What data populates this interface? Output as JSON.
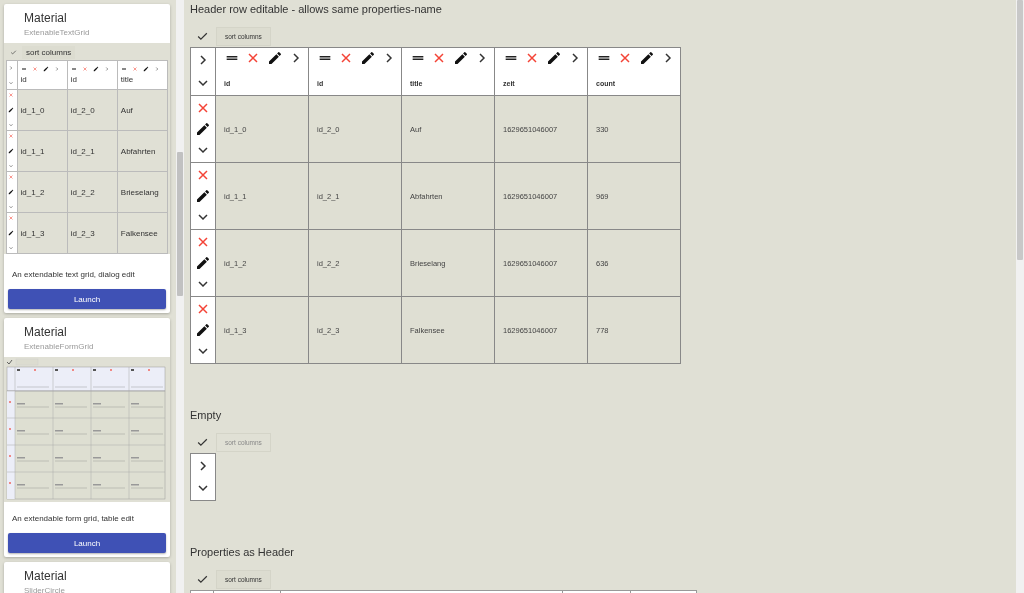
{
  "sidebar": {
    "cards": [
      {
        "title": "Material",
        "subtitle": "ExtenableTextGrid",
        "preview": {
          "kind": "text_grid",
          "sort_label": "sort columns",
          "columns": [
            "id",
            "id",
            "title"
          ],
          "rows": [
            [
              "id_1_0",
              "id_2_0",
              "Auf"
            ],
            [
              "id_1_1",
              "id_2_1",
              "Abfahrten"
            ],
            [
              "id_1_2",
              "id_2_2",
              "Brieselang"
            ],
            [
              "id_1_3",
              "id_2_3",
              "Falkensee"
            ]
          ]
        },
        "description": "An extendable text grid, dialog edit",
        "button": "Launch"
      },
      {
        "title": "Material",
        "subtitle": "ExtenableFormGrid",
        "preview": {
          "kind": "form_grid"
        },
        "description": "An extendable form grid, table edit",
        "button": "Launch"
      },
      {
        "title": "Material",
        "subtitle": "SliderCircle"
      }
    ]
  },
  "sections": [
    {
      "kind": "grid",
      "title": "Header row editable - allows same properties-name",
      "sort_label": "sort columns",
      "sort_disabled": false,
      "columns": [
        "id",
        "id",
        "title",
        "zeit",
        "count"
      ],
      "rows": [
        [
          "id_1_0",
          "id_2_0",
          "Auf",
          "1629651046007",
          "330"
        ],
        [
          "id_1_1",
          "id_2_1",
          "Abfahrten",
          "1629651046007",
          "969"
        ],
        [
          "id_1_2",
          "id_2_2",
          "Brieselang",
          "1629651046007",
          "636"
        ],
        [
          "id_1_3",
          "id_2_3",
          "Falkensee",
          "1629651046007",
          "778"
        ]
      ]
    },
    {
      "kind": "empty",
      "title": "Empty",
      "sort_label": "sort columns",
      "sort_disabled": true
    },
    {
      "kind": "header_only",
      "title": "Properties as Header",
      "sort_label": "sort columns",
      "sort_disabled": false
    }
  ]
}
